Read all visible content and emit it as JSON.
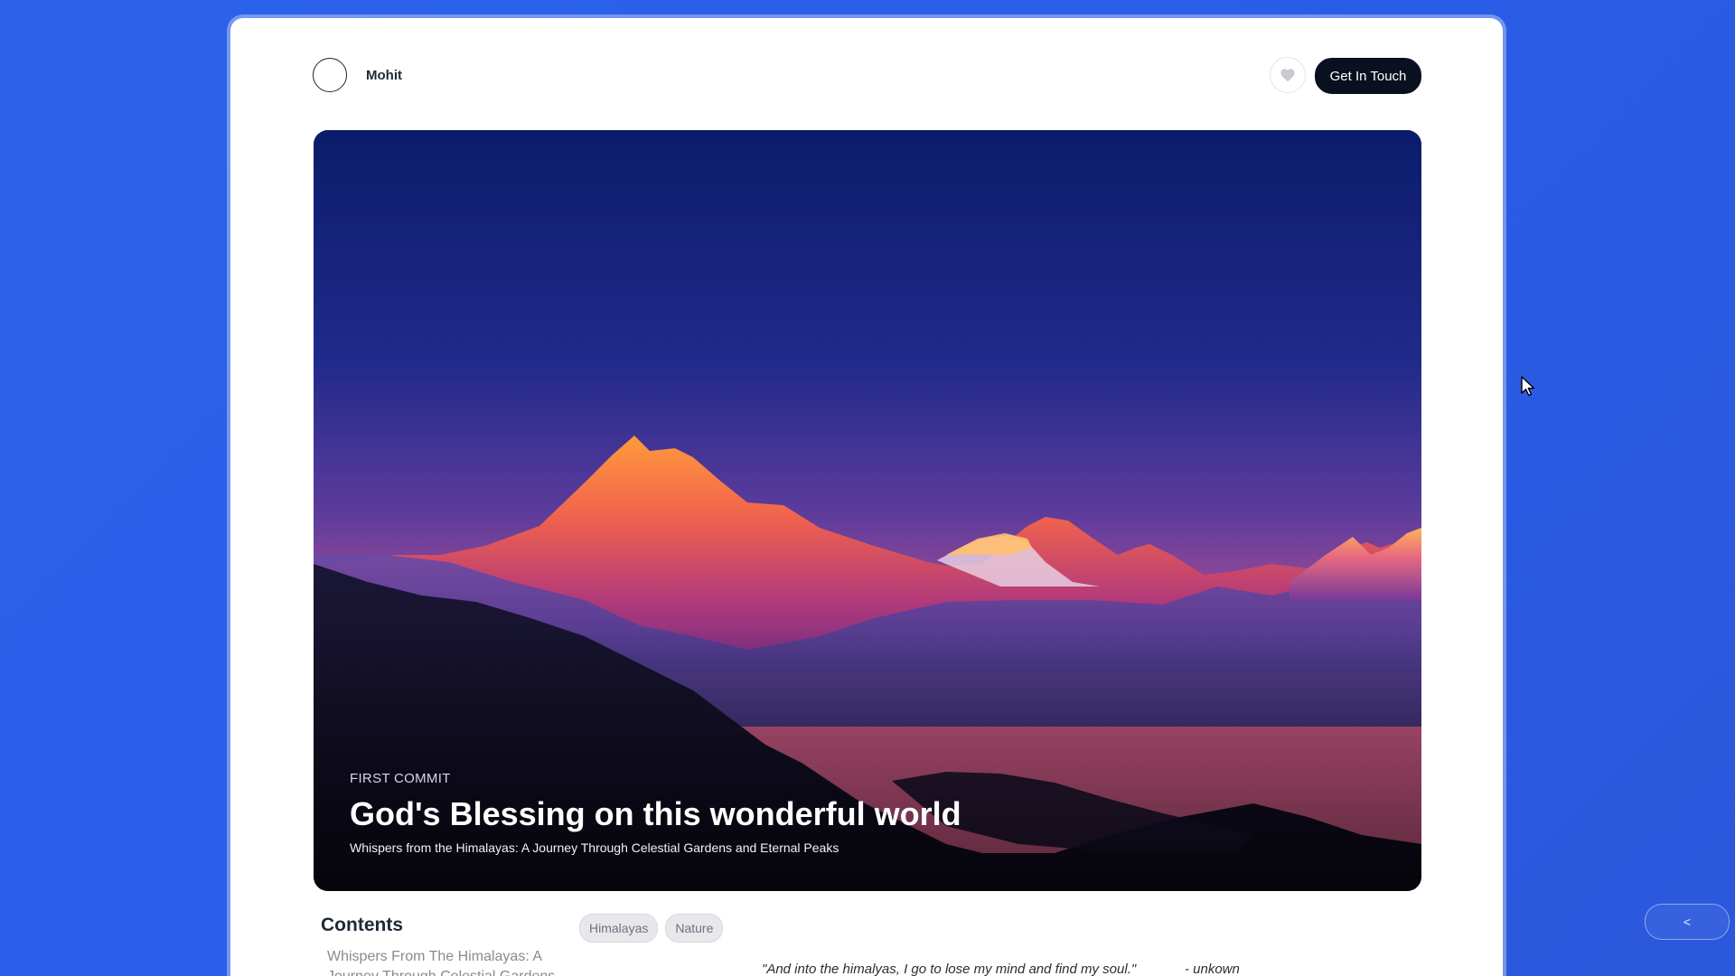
{
  "header": {
    "author_name": "Mohit",
    "like_icon": "heart-icon",
    "cta_label": "Get In Touch"
  },
  "hero": {
    "eyebrow": "FIRST COMMIT",
    "title": "God's Blessing on this wonderful world",
    "subtitle": "Whispers from the Himalayas: A Journey Through Celestial Gardens and Eternal Peaks"
  },
  "contents": {
    "heading": "Contents",
    "items": [
      "Whispers From The Himalayas: A Journey Through Celestial Gardens"
    ]
  },
  "tags": [
    "Himalayas",
    "Nature"
  ],
  "quote": {
    "text": "\"And into the himalyas, I go to lose my mind and find my soul.\"",
    "author": "- unkown"
  },
  "side_button": {
    "label": "<"
  },
  "colors": {
    "background": "#2c62ea",
    "card": "#ffffff",
    "cta": "#0b1020"
  }
}
